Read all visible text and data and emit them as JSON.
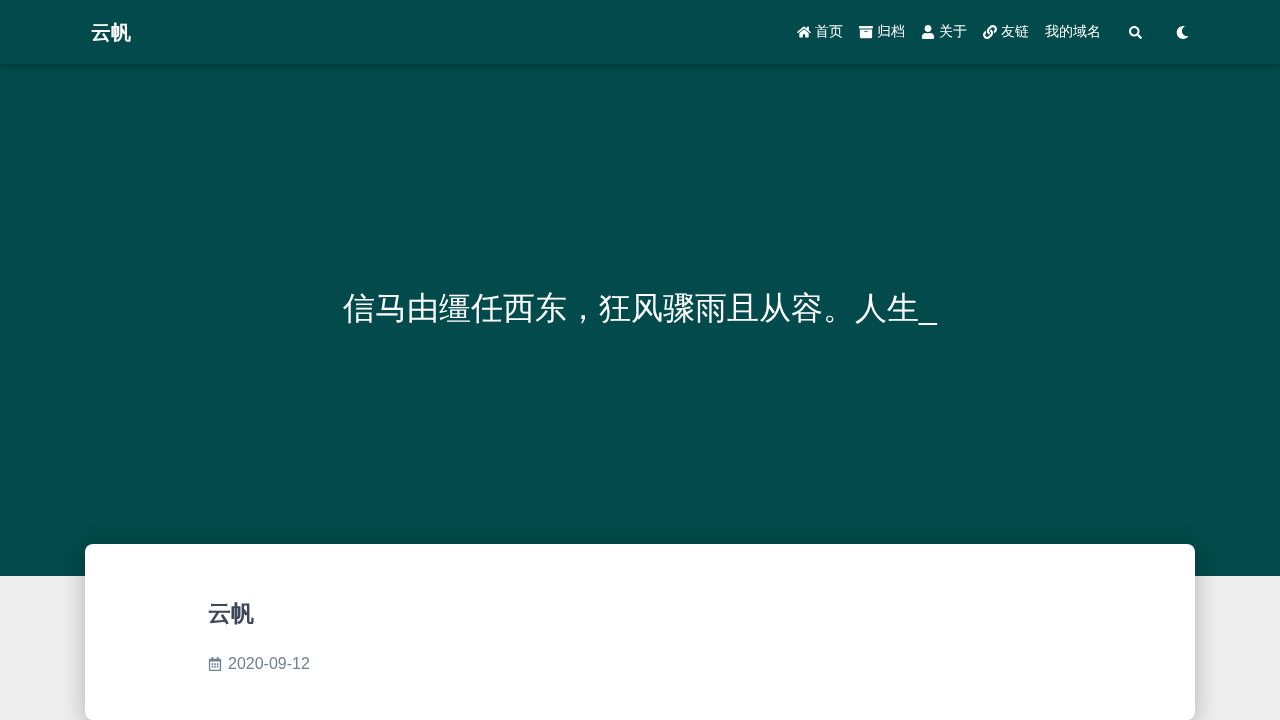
{
  "header": {
    "brand": "云帆",
    "nav": [
      {
        "kind": "home",
        "label": "首页"
      },
      {
        "kind": "archive",
        "label": "归档"
      },
      {
        "kind": "user",
        "label": "关于"
      },
      {
        "kind": "link",
        "label": "友链"
      },
      {
        "kind": "text",
        "label": "我的域名"
      }
    ],
    "tools": [
      {
        "kind": "search"
      },
      {
        "kind": "moon"
      }
    ]
  },
  "hero": {
    "slogan": "信马由缰任西东，狂风骤雨且从容。人生_"
  },
  "post": {
    "title": "云帆",
    "date": "2020-09-12"
  }
}
